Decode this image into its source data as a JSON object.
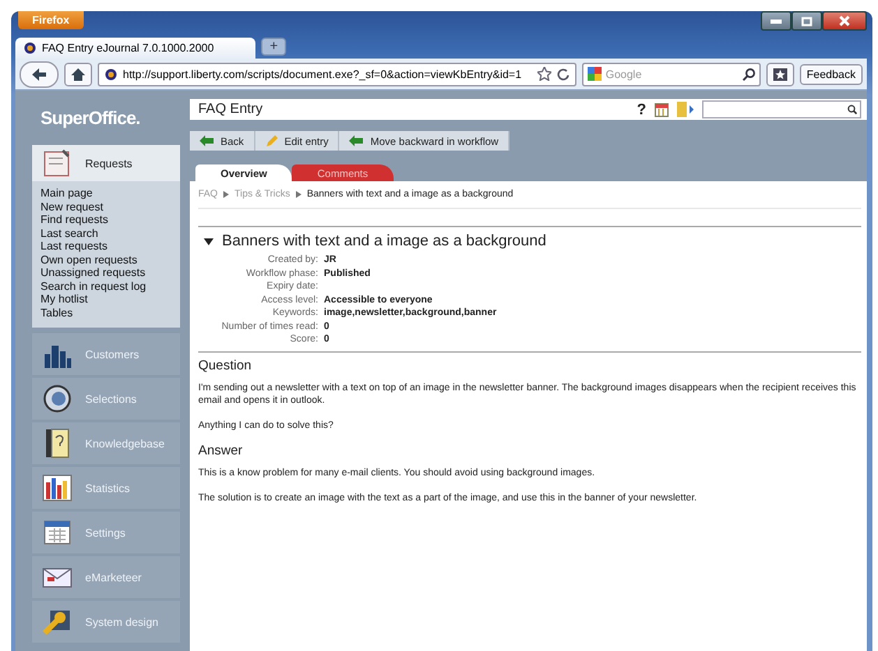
{
  "browser": {
    "menu_button": "Firefox",
    "tab_title": "FAQ Entry eJournal 7.0.1000.2000",
    "new_tab": "+",
    "url": "http://support.liberty.com/scripts/document.exe?_sf=0&action=viewKbEntry&id=1",
    "search_placeholder": "Google",
    "feedback": "Feedback"
  },
  "sidebar": {
    "logo": "SuperOffice.",
    "items": [
      {
        "label": "Requests",
        "expanded": true,
        "links": [
          "Main page",
          "New request",
          "Find requests",
          "Last search",
          "Last requests",
          "Own open requests",
          "Unassigned requests",
          "Search in request log",
          "My hotlist",
          "Tables"
        ]
      },
      {
        "label": "Customers",
        "expanded": false
      },
      {
        "label": "Selections",
        "expanded": false
      },
      {
        "label": "Knowledgebase",
        "expanded": false
      },
      {
        "label": "Statistics",
        "expanded": false
      },
      {
        "label": "Settings",
        "expanded": false
      },
      {
        "label": "eMarketeer",
        "expanded": false
      },
      {
        "label": "System design",
        "expanded": false
      }
    ]
  },
  "header": {
    "title": "FAQ Entry",
    "help": "?"
  },
  "toolbar": [
    "Back",
    "Edit entry",
    "Move backward in workflow"
  ],
  "tabs": [
    {
      "label": "Overview",
      "selected": true
    },
    {
      "label": "Comments",
      "selected": false
    }
  ],
  "breadcrumb": [
    "FAQ",
    "Tips & Tricks",
    "Banners with text and a image as a background"
  ],
  "entry": {
    "title": "Banners with text and a image as a background",
    "expanded": true,
    "fields": [
      {
        "label": "Created by:",
        "value": "JR"
      },
      {
        "label": "Workflow phase:",
        "value": "Published"
      },
      {
        "label": "Expiry date:"
      },
      {
        "label": "Access level:",
        "value": "Accessible to everyone"
      },
      {
        "label": "Keywords:",
        "value": "image,newsletter,background,banner"
      },
      {
        "label": "Number of times read:",
        "value": "0"
      },
      {
        "label": "Score:",
        "value": "0"
      }
    ]
  },
  "sections": [
    {
      "heading": "Question",
      "paragraphs": [
        "I'm sending out a newsletter with a text on top of an image in the newsletter banner. The background images disappears when the recipient receives this email and opens it in outlook.",
        "Anything I can do to solve this?"
      ]
    },
    {
      "heading": "Answer",
      "paragraphs": [
        "This is a know problem for many e-mail clients. You should avoid using background images.",
        "The solution is to create an image with the text as a part of the image, and use this in the banner of your newsletter."
      ]
    }
  ]
}
